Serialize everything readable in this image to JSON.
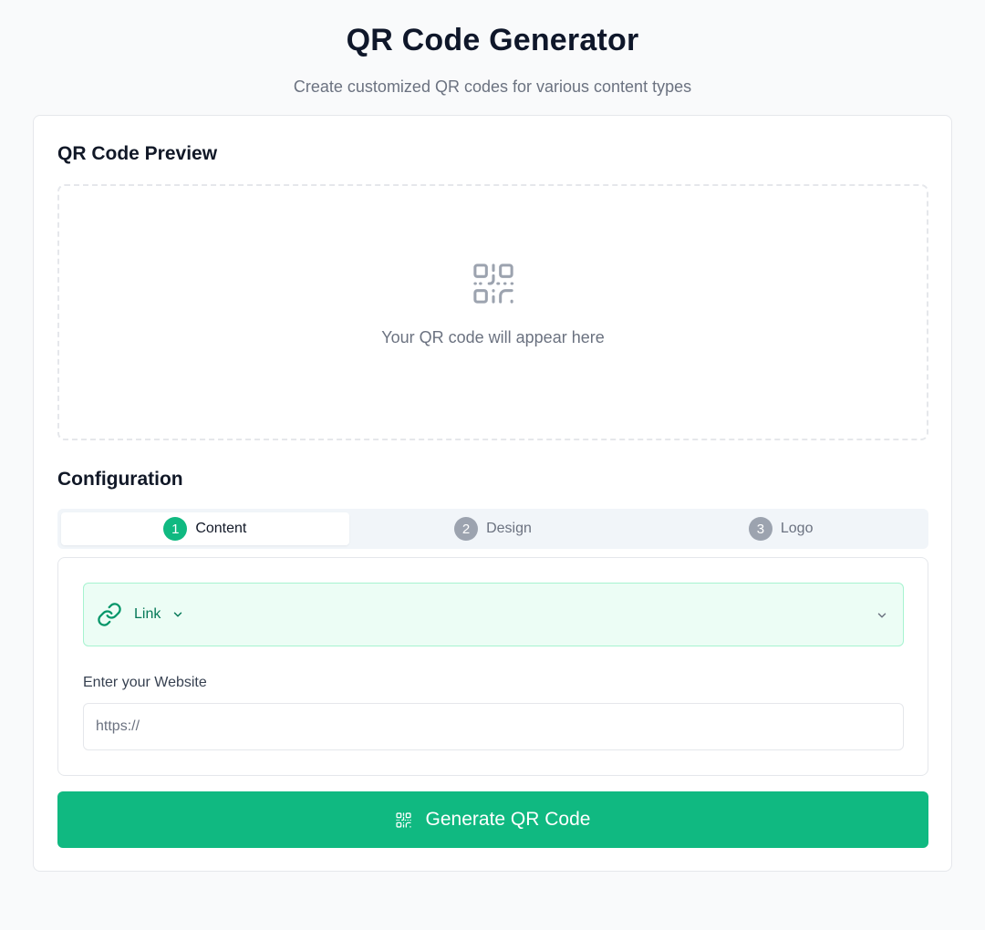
{
  "header": {
    "title": "QR Code Generator",
    "subtitle": "Create customized QR codes for various content types"
  },
  "preview": {
    "title": "QR Code Preview",
    "placeholder_icon": "qr-code-icon",
    "placeholder_text": "Your QR code will appear here"
  },
  "config": {
    "title": "Configuration",
    "tabs": [
      {
        "number": "1",
        "label": "Content",
        "active": true
      },
      {
        "number": "2",
        "label": "Design",
        "active": false
      },
      {
        "number": "3",
        "label": "Logo",
        "active": false
      }
    ]
  },
  "content": {
    "type_select": {
      "icon": "link-icon",
      "label": "Link"
    },
    "url_field": {
      "label": "Enter your Website",
      "placeholder": "https://",
      "value": ""
    }
  },
  "actions": {
    "generate_label": "Generate QR Code",
    "generate_icon": "qr-code-icon"
  },
  "colors": {
    "accent": "#10b981",
    "accent_light_bg": "#ecfdf5",
    "accent_border": "#a7f3d0",
    "accent_text": "#047857",
    "inactive_tab_badge": "#9ca3af",
    "tabs_background": "#f1f5f9",
    "page_background": "#f9fafb"
  }
}
